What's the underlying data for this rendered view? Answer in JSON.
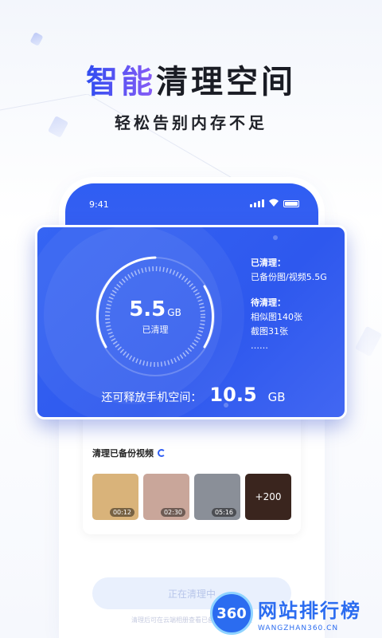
{
  "headline": {
    "accent": "智能",
    "rest": "清理空间"
  },
  "subheadline": "轻松告别内存不足",
  "status_bar": {
    "time": "9:41"
  },
  "clean_card": {
    "cleaned_value": "5.5",
    "cleaned_unit": "GB",
    "cleaned_label": "已清理",
    "done_header": "已清理：",
    "done_item": "已备份图/视频5.5G",
    "pending_header": "待清理：",
    "pending_items": [
      "相似图140张",
      "截图31张",
      "……"
    ],
    "free_label": "还可释放手机空间：",
    "free_value": "10.5",
    "free_unit": "GB"
  },
  "video_section": {
    "title": "清理已备份视频",
    "videos": [
      {
        "duration": "00:12",
        "thumb": "#d9b37a"
      },
      {
        "duration": "02:30",
        "thumb": "#c9a69a"
      },
      {
        "duration": "05:16",
        "thumb": "#8a8f98"
      },
      {
        "overlay": "+200",
        "thumb": "#5a3a2e"
      }
    ]
  },
  "photo_thumbs": [
    "#4a5260",
    "#6c8fa0",
    "#3d4a52",
    "#5a4a40"
  ],
  "clean_button": "正在清理中",
  "footnote": "清理后可在云端相册查看已备份的照片视频",
  "watermark": {
    "badge": "360",
    "name": "网站排行榜",
    "url": "WANGZHAN360.CN"
  },
  "colors": {
    "primary": "#2f5df3",
    "accent_purple": "#8b5cf6"
  }
}
